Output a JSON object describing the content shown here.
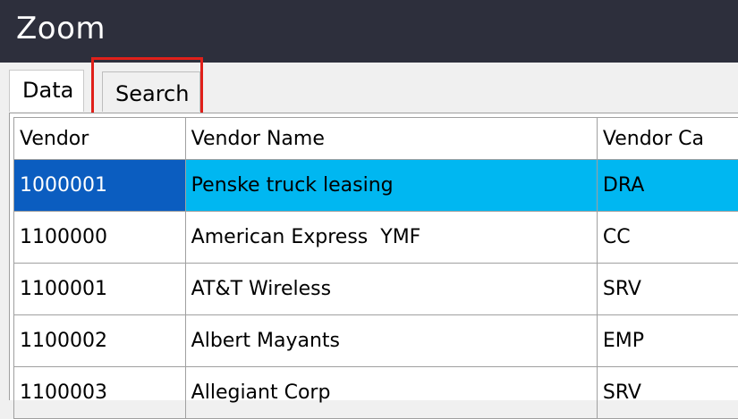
{
  "window": {
    "title": "Zoom"
  },
  "tabs": [
    {
      "label": "Data"
    },
    {
      "label": "Search"
    }
  ],
  "table": {
    "columns": [
      "Vendor",
      "Vendor Name",
      "Vendor Ca"
    ],
    "rows": [
      {
        "vendor": "1000001",
        "name": "Penske truck leasing",
        "category": "DRA"
      },
      {
        "vendor": "1100000",
        "name": "American Express  YMF",
        "category": "CC"
      },
      {
        "vendor": "1100001",
        "name": "AT&T Wireless",
        "category": "SRV"
      },
      {
        "vendor": "1100002",
        "name": "Albert Mayants",
        "category": "EMP"
      },
      {
        "vendor": "1100003",
        "name": "Allegiant Corp",
        "category": "SRV"
      }
    ]
  },
  "colors": {
    "title_bar": "#2d2f3c",
    "selected_row": "#00b7f1",
    "selected_cell": "#0b5dc0",
    "highlight_box": "#e0201a"
  }
}
